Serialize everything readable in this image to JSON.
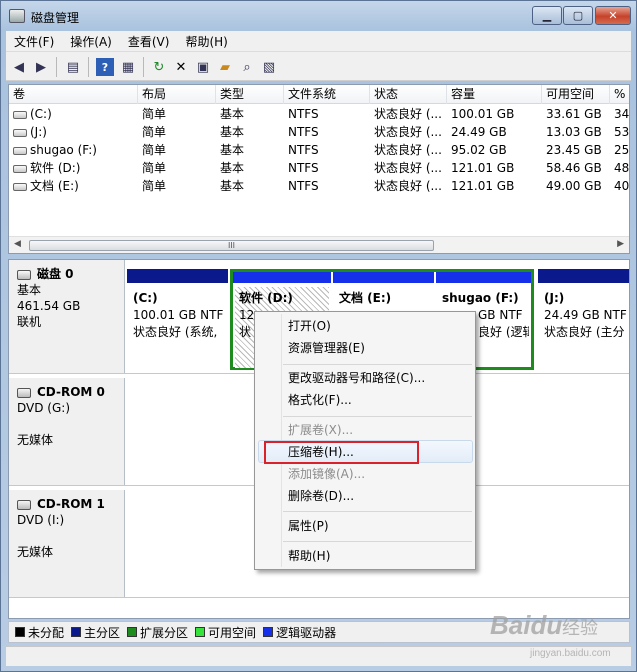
{
  "window": {
    "title": "磁盘管理",
    "controls": {
      "minimize": "▁",
      "maximize": "▢",
      "close": "✕"
    }
  },
  "menu": [
    "文件(F)",
    "操作(A)",
    "查看(V)",
    "帮助(H)"
  ],
  "toolbar_icons": [
    "back-arrow-icon",
    "forward-arrow-icon",
    "show-hide-console-tree-icon",
    "help-icon",
    "properties-pane-icon",
    "refresh-icon",
    "delete-icon",
    "properties-icon",
    "open-folder-icon",
    "search-icon",
    "export-icon"
  ],
  "volume_table": {
    "columns": [
      "卷",
      "布局",
      "类型",
      "文件系统",
      "状态",
      "容量",
      "可用空间",
      "%"
    ],
    "rows": [
      {
        "vol": "(C:)",
        "layout": "简单",
        "type": "基本",
        "fs": "NTFS",
        "status": "状态良好 (...",
        "capacity": "100.01 GB",
        "free": "33.61 GB",
        "pct": "34"
      },
      {
        "vol": "(J:)",
        "layout": "简单",
        "type": "基本",
        "fs": "NTFS",
        "status": "状态良好 (...",
        "capacity": "24.49 GB",
        "free": "13.03 GB",
        "pct": "53"
      },
      {
        "vol": "shugao (F:)",
        "layout": "简单",
        "type": "基本",
        "fs": "NTFS",
        "status": "状态良好 (...",
        "capacity": "95.02 GB",
        "free": "23.45 GB",
        "pct": "25"
      },
      {
        "vol": "软件 (D:)",
        "layout": "简单",
        "type": "基本",
        "fs": "NTFS",
        "status": "状态良好 (...",
        "capacity": "121.01 GB",
        "free": "58.46 GB",
        "pct": "48"
      },
      {
        "vol": "文档 (E:)",
        "layout": "简单",
        "type": "基本",
        "fs": "NTFS",
        "status": "状态良好 (...",
        "capacity": "121.01 GB",
        "free": "49.00 GB",
        "pct": "40"
      }
    ],
    "scroll_grip": "III"
  },
  "disks": [
    {
      "name": "磁盘 0",
      "type": "基本",
      "size": "461.54 GB",
      "state": "联机",
      "partitions": [
        {
          "name": "(C:)",
          "line2": "100.01 GB NTF",
          "line3": "状态良好 (系统,"
        },
        {
          "name": "软件  (D:)",
          "line2": "12",
          "line3": "状"
        },
        {
          "name": "文档  (E:)",
          "line2": "",
          "line3": ""
        },
        {
          "name": "shugao  (F:)",
          "line2": "GB NTF",
          "line3": "良好 (逻辑"
        },
        {
          "name": "(J:)",
          "line2": "24.49 GB NTF",
          "line3": "状态良好 (主分"
        }
      ]
    },
    {
      "name": "CD-ROM 0",
      "type": "DVD (G:)",
      "size": "",
      "state": "无媒体"
    },
    {
      "name": "CD-ROM 1",
      "type": "DVD (I:)",
      "size": "",
      "state": "无媒体"
    }
  ],
  "legend": [
    {
      "label": "未分配",
      "color": "#000000"
    },
    {
      "label": "主分区",
      "color": "#0a1a8c"
    },
    {
      "label": "扩展分区",
      "color": "#1e8b1e"
    },
    {
      "label": "可用空间",
      "color": "#36e33a"
    },
    {
      "label": "逻辑驱动器",
      "color": "#1530e8"
    }
  ],
  "context_menu": {
    "items": [
      {
        "label": "打开(O)",
        "enabled": true
      },
      {
        "label": "资源管理器(E)",
        "enabled": true
      },
      {
        "label": "更改驱动器号和路径(C)...",
        "enabled": true
      },
      {
        "label": "格式化(F)...",
        "enabled": true
      },
      {
        "label": "扩展卷(X)...",
        "enabled": false
      },
      {
        "label": "压缩卷(H)...",
        "enabled": true,
        "highlighted": true
      },
      {
        "label": "添加镜像(A)...",
        "enabled": false
      },
      {
        "label": "删除卷(D)...",
        "enabled": true
      },
      {
        "label": "属性(P)",
        "enabled": true
      },
      {
        "label": "帮助(H)",
        "enabled": true
      }
    ]
  },
  "watermark": {
    "brand": "Baidu",
    "text": "经验",
    "url": "jingyan.baidu.com"
  }
}
